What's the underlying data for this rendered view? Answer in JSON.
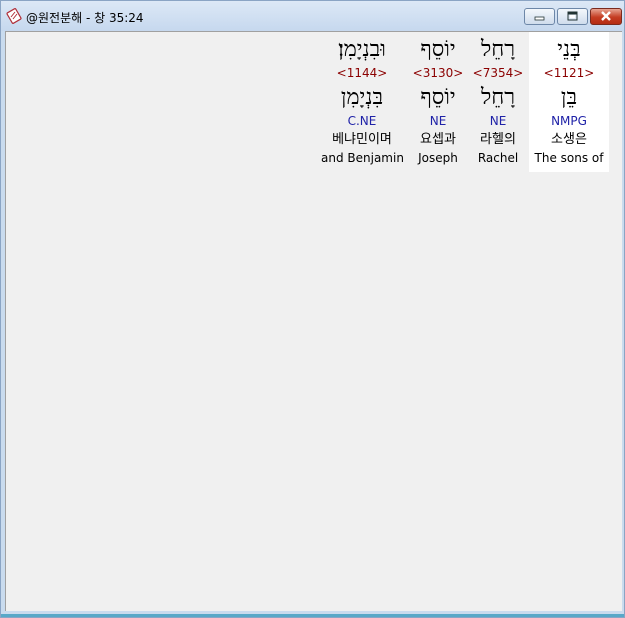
{
  "window": {
    "title": "@원전분해 - 창 35:24"
  },
  "words": [
    {
      "hebrew": "בְּנֵי",
      "strong": "<1121>",
      "lemma": "בֵּן",
      "morph": "NMPG",
      "korean": "소생은",
      "english": "The sons of",
      "selected": true
    },
    {
      "hebrew": "רָחֵל",
      "strong": "<7354>",
      "lemma": "רָחֵל",
      "morph": "NE",
      "korean": "라헬의",
      "english": "Rachel",
      "selected": false
    },
    {
      "hebrew": "יוֹסֵף",
      "strong": "<3130>",
      "lemma": "יוֹסֵף",
      "morph": "NE",
      "korean": "요셉과",
      "english": "Joseph",
      "selected": false
    },
    {
      "hebrew": "וּבִנְיָמִן׃",
      "strong": "<1144>",
      "lemma": "בִּנְיָמִן",
      "morph": "C.NE",
      "korean": "베냐민이며",
      "english": "and Benjamin",
      "selected": false
    }
  ]
}
